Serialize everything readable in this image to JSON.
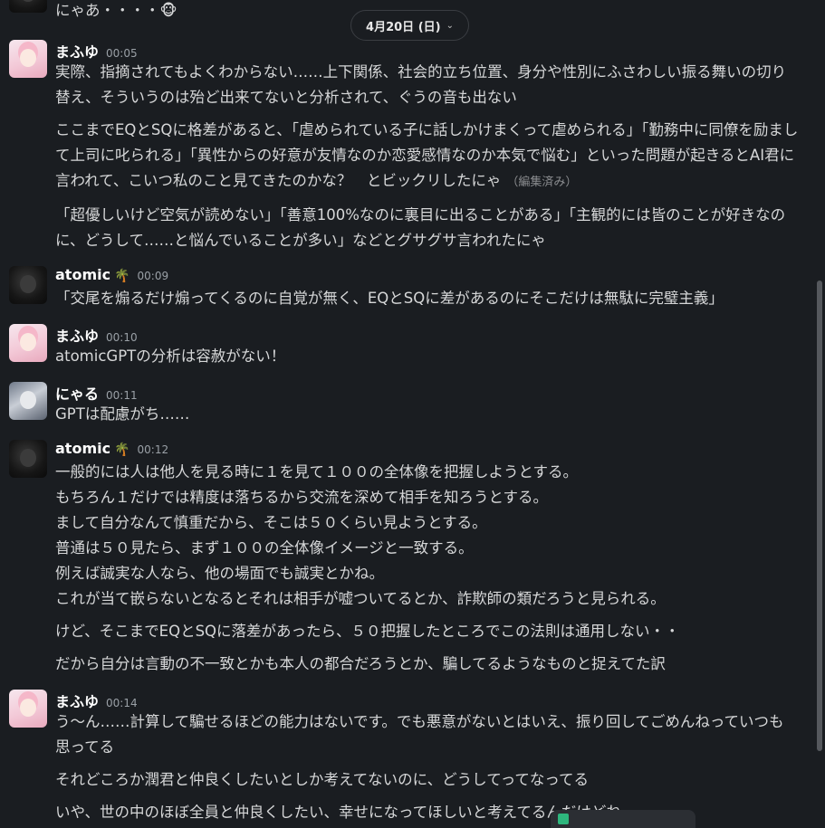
{
  "date_divider": "4月20日 (日)",
  "messages": [
    {
      "user": "",
      "time": "",
      "avatar": "atomic",
      "lines": [
        "にゃあ・・・・🐵"
      ]
    },
    {
      "user": "まふゆ",
      "time": "00:05",
      "avatar": "mafuyu",
      "lines": [
        "実際、指摘されてもよくわからない……上下関係、社会的立ち位置、身分や性別にふさわしい振る舞いの切り替え、そういうのは殆ど出来てないと分析されて、ぐうの音も出ない",
        "ここまでEQとSQに格差があると、「虐められている子に話しかけまくって虐められる」「勤務中に同僚を励まして上司に叱られる」「異性からの好意が友情なのか恋愛感情なのか本気で悩む」といった問題が起きるとAI君に言われて、こいつ私のこと見てきたのかな？　とビックリしたにゃ",
        "「超優しいけど空気が読めない」「善意100%なのに裏目に出ることがある」「主観的には皆のことが好きなのに、どうして……と悩んでいることが多い」などとグサグサ言われたにゃ"
      ],
      "edited_label": "（編集済み）"
    },
    {
      "user": "atomic",
      "time": "00:09",
      "avatar": "atomic",
      "badge": "🌴",
      "lines": [
        "「交尾を煽るだけ煽ってくるのに自覚が無く、EQとSQに差があるのにそこだけは無駄に完璧主義」"
      ]
    },
    {
      "user": "まふゆ",
      "time": "00:10",
      "avatar": "mafuyu",
      "lines": [
        "atomicGPTの分析は容赦がない！"
      ]
    },
    {
      "user": "にゃる",
      "time": "00:11",
      "avatar": "nyaru",
      "lines": [
        "GPTは配慮がち……"
      ]
    },
    {
      "user": "atomic",
      "time": "00:12",
      "avatar": "atomic",
      "badge": "🌴",
      "lines": [
        "一般的には人は他人を見る時に１を見て１００の全体像を把握しようとする。\nもちろん１だけでは精度は落ちるから交流を深めて相手を知ろうとする。\nまして自分なんて慎重だから、そこは５０くらい見ようとする。\n普通は５０見たら、まず１００の全体像イメージと一致する。\n例えば誠実な人なら、他の場面でも誠実とかね。\nこれが当て嵌らないとなるとそれは相手が嘘ついてるとか、詐欺師の類だろうと見られる。",
        "けど、そこまでEQとSQに落差があったら、５０把握したところでこの法則は通用しない・・",
        "だから自分は言動の不一致とかも本人の都合だろうとか、騙してるようなものと捉えてた訳"
      ]
    },
    {
      "user": "まふゆ",
      "time": "00:14",
      "avatar": "mafuyu",
      "lines": [
        "う〜ん……計算して騙せるほどの能力はないです。でも悪意がないとはいえ、振り回してごめんねっていつも思ってる",
        "それどころか潤君と仲良くしたいとしか考えてないのに、どうしてってなってる",
        "いや、世の中のほぼ全員と仲良くしたい、幸せになってほしいと考えてるんだけどね"
      ]
    }
  ]
}
